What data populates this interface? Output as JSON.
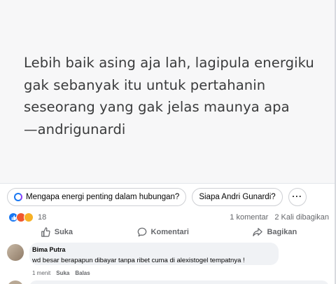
{
  "quote": {
    "lines": [
      "Lebih baik asing aja lah, lagipula energiku",
      "gak sebanyak itu untuk pertahanin",
      "seseorang yang gak jelas maunya apa",
      "—andrigunardi"
    ]
  },
  "suggestions": [
    "Mengapa energi penting dalam hubungan?",
    "Siapa Andri Gunardi?"
  ],
  "more_label": "···",
  "stats": {
    "reaction_count": "18",
    "comments": "1 komentar",
    "shares": "2 Kali dibagikan",
    "reaction_icons": [
      "like-icon",
      "angry-icon",
      "wow-icon"
    ]
  },
  "actions": {
    "like": "Suka",
    "comment": "Komentari",
    "share": "Bagikan"
  },
  "comment": {
    "author": "Bima Putra",
    "text": "wd besar berapapun dibayar tanpa ribet cuma di alexistogel tempatnya !",
    "time": "1 menit",
    "like": "Suka",
    "reply": "Balas"
  },
  "colors": {
    "accent": "#1877f2",
    "muted": "#65676b",
    "bubble": "#f0f2f5"
  }
}
